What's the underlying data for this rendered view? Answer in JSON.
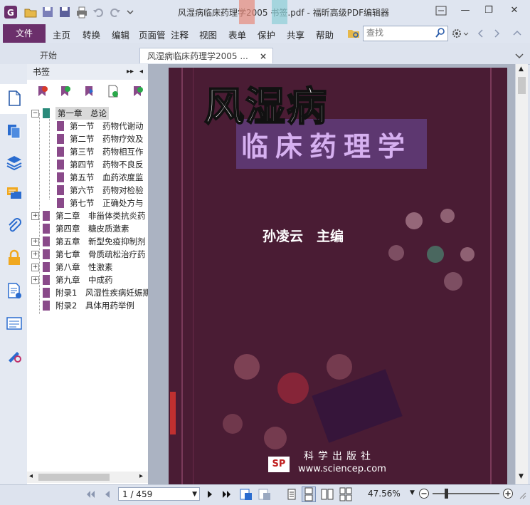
{
  "window": {
    "title": "风湿病临床药理学2005 书签.pdf - 福昕高级PDF编辑器",
    "controls": {
      "minimize": "—",
      "restore": "❐",
      "close": "✕"
    }
  },
  "menu": {
    "file": "文件",
    "items": [
      "主页",
      "转换",
      "编辑",
      "页面管",
      "注释",
      "视图",
      "表单",
      "保护",
      "共享",
      "帮助"
    ],
    "search_placeholder": "查找"
  },
  "tabs": [
    {
      "label": "开始"
    },
    {
      "label": "风湿病临床药理学2005 ...",
      "close": "×"
    }
  ],
  "bookmarks": {
    "header": "书签",
    "items": [
      {
        "label": "第一章　总论",
        "level": 0,
        "expanded": true,
        "selected": true
      },
      {
        "label": "第一节　药物代谢动",
        "level": 1
      },
      {
        "label": "第二节　药物疗效及",
        "level": 1
      },
      {
        "label": "第三节　药物相互作",
        "level": 1
      },
      {
        "label": "第四节　药物不良反",
        "level": 1
      },
      {
        "label": "第五节　血药浓度监",
        "level": 1
      },
      {
        "label": "第六节　药物对检验",
        "level": 1
      },
      {
        "label": "第七节　正确处方与",
        "level": 1
      },
      {
        "label": "第二章　非甾体类抗炎药",
        "level": 0,
        "expandable": true
      },
      {
        "label": "第四章　糖皮质激素",
        "level": 0
      },
      {
        "label": "第五章　新型免疫抑制剂",
        "level": 0,
        "expandable": true
      },
      {
        "label": "第七章　骨质疏松治疗药",
        "level": 0,
        "expandable": true
      },
      {
        "label": "第八章　性激素",
        "level": 0,
        "expandable": true
      },
      {
        "label": "第九章　中成药",
        "level": 0,
        "expandable": true
      },
      {
        "label": "附录1　风湿性疾病妊娠期",
        "level": 0
      },
      {
        "label": "附录2　具体用药举例",
        "level": 0
      }
    ]
  },
  "document": {
    "cover_title": "风湿病",
    "cover_subtitle": "临床药理学",
    "author": "孙凌云　主编",
    "publisher": "科学出版社",
    "publisher_url": "www.sciencep.com",
    "logo_text": "SP"
  },
  "status": {
    "page": "1 / 459",
    "zoom": "47.56%"
  },
  "colors": {
    "accent": "#6b2f6b",
    "cover": "#4a1c34"
  }
}
